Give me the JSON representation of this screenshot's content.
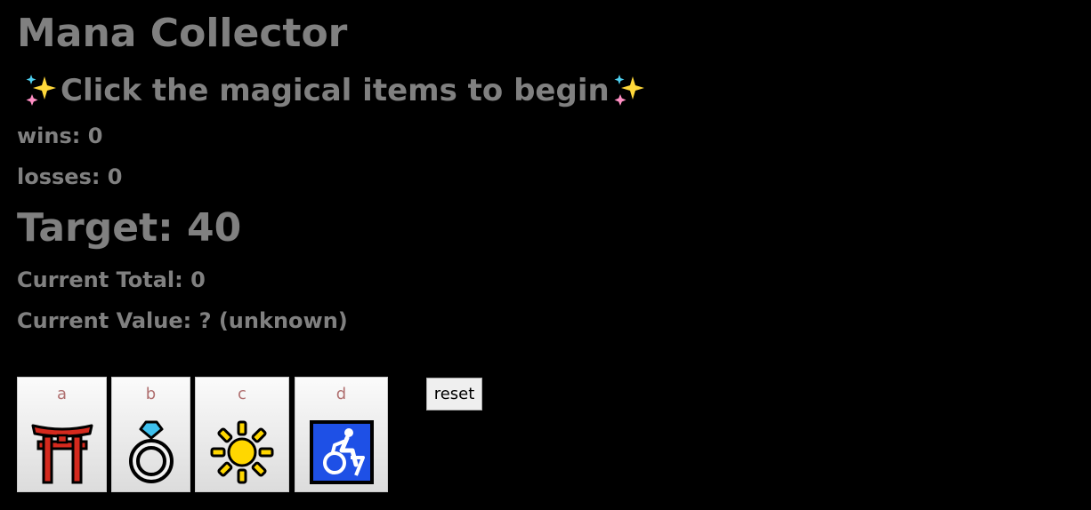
{
  "game": {
    "title": "Mana Collector",
    "subtitle": "Click the magical items to begin",
    "wins_text": "wins: 0",
    "losses_text": "losses: 0",
    "target_text": "Target: 40",
    "current_total_text": "Current Total: 0",
    "current_value_text": "Current Value: ? (unknown)"
  },
  "items": [
    {
      "letter": "a",
      "icon": "shinto-shrine-icon"
    },
    {
      "letter": "b",
      "icon": "ring-icon"
    },
    {
      "letter": "c",
      "icon": "sun-icon"
    },
    {
      "letter": "d",
      "icon": "wheelchair-icon"
    }
  ],
  "controls": {
    "reset_label": "reset"
  },
  "colors": {
    "background": "#000000",
    "text": "#808080",
    "letter": "#b07070"
  }
}
